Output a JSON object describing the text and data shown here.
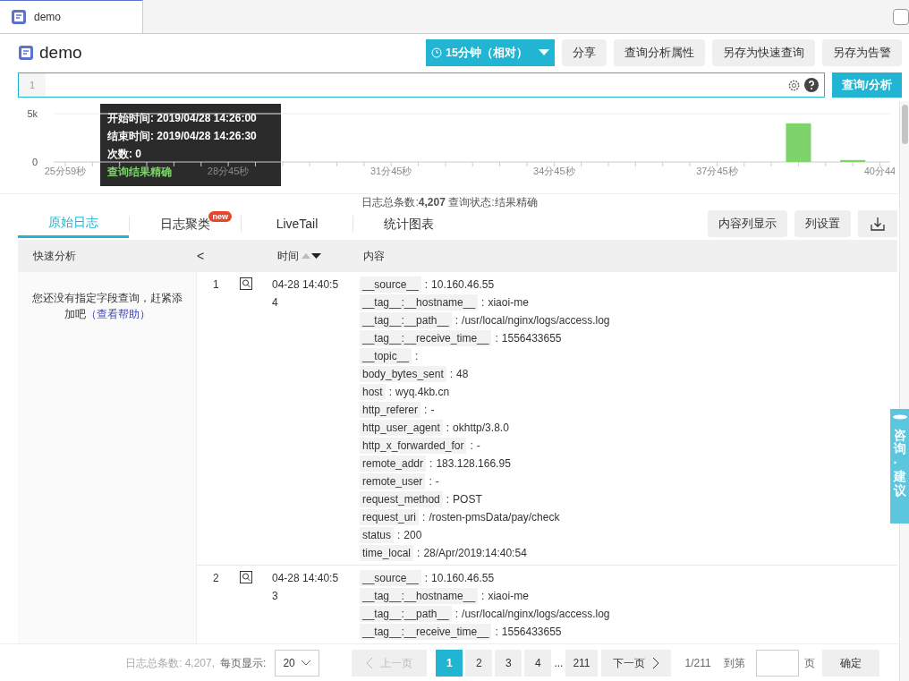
{
  "tab": {
    "label": "demo",
    "selected": true
  },
  "header": {
    "title": "demo",
    "time_range": "15分钟（相对）",
    "buttons": [
      "分享",
      "查询分析属性",
      "另存为快速查询",
      "另存为告警"
    ]
  },
  "query": {
    "line_number": "1",
    "submit": "查询/分析"
  },
  "histogram": {
    "chart_data": {
      "type": "bar",
      "categories": [
        "25分59秒",
        null,
        null,
        null,
        null,
        null,
        "28分45秒",
        null,
        null,
        null,
        null,
        null,
        "31分45秒",
        null,
        null,
        null,
        null,
        null,
        "34分45秒",
        null,
        null,
        null,
        null,
        null,
        "37分45秒",
        null,
        null,
        null,
        null,
        null,
        "40分44"
      ],
      "series": [
        {
          "color": "#7ed36b",
          "values": [
            0,
            0,
            0,
            0,
            0,
            0,
            0,
            0,
            0,
            0,
            0,
            0,
            0,
            0,
            0,
            0,
            0,
            0,
            0,
            0,
            0,
            0,
            0,
            0,
            0,
            0,
            0,
            4000,
            0,
            200,
            0
          ]
        }
      ],
      "ylim": [
        0,
        5000
      ],
      "yticks": [
        {
          "value": 0,
          "label": "0"
        },
        {
          "value": 5000,
          "label": "5k"
        }
      ]
    },
    "tooltip": {
      "lines": [
        "开始时间: 2019/04/28 14:26:00",
        "结束时间: 2019/04/28 14:26:30",
        "次数: 0"
      ],
      "status": "查询结果精确"
    }
  },
  "summary": "日志总条数:**4,207** 查询状态:结果精确",
  "view_tabs": [
    {
      "label": "原始日志",
      "selected": true
    },
    {
      "label": "日志聚类",
      "selected": false,
      "badge": "new"
    },
    {
      "label": "LiveTail",
      "selected": false
    },
    {
      "label": "统计图表",
      "selected": false
    }
  ],
  "view_buttons": [
    "内容列显示",
    "列设置"
  ],
  "table": {
    "columns": [
      "快速分析",
      "<",
      "时间",
      "内容"
    ],
    "quick_analysis": {
      "message": "您还没有指定字段查询，赶紧添加吧",
      "link": "（查看帮助）"
    },
    "rows": [
      {
        "index": "1",
        "time": "04-28 14:40:54",
        "fields": [
          {
            "key": "__source__",
            "separator": ":",
            "value": "10.160.46.55"
          },
          {
            "key": "__tag__:__hostname__",
            "separator": ":",
            "value": "xiaoi-me"
          },
          {
            "key": "__tag__:__path__",
            "separator": ":",
            "value": "/usr/local/nginx/logs/access.log"
          },
          {
            "key": "__tag__:__receive_time__",
            "separator": ":",
            "value": "1556433655"
          },
          {
            "key": "__topic__",
            "separator": ":"
          },
          {
            "key": "body_bytes_sent",
            "separator": ":",
            "value": "48"
          },
          {
            "key": "host",
            "separator": ":",
            "value": "wyq.4kb.cn"
          },
          {
            "key": "http_referer",
            "separator": ":",
            "value": "-"
          },
          {
            "key": "http_user_agent",
            "separator": ":",
            "value": "okhttp/3.8.0"
          },
          {
            "key": "http_x_forwarded_for",
            "separator": ":",
            "value": "-"
          },
          {
            "key": "remote_addr",
            "separator": ":",
            "value": "183.128.166.95"
          },
          {
            "key": "remote_user",
            "separator": ":",
            "value": "-"
          },
          {
            "key": "request_method",
            "separator": ":",
            "value": "POST"
          },
          {
            "key": "request_uri",
            "separator": ":",
            "value": "/rosten-pmsData/pay/check"
          },
          {
            "key": "status",
            "separator": ":",
            "value": "200"
          },
          {
            "key": "time_local",
            "separator": ":",
            "value": "28/Apr/2019:14:40:54"
          }
        ]
      },
      {
        "index": "2",
        "time": "04-28 14:40:53",
        "fields": [
          {
            "key": "__source__",
            "separator": ":",
            "value": "10.160.46.55"
          },
          {
            "key": "__tag__:__hostname__",
            "separator": ":",
            "value": "xiaoi-me"
          },
          {
            "key": "__tag__:__path__",
            "separator": ":",
            "value": "/usr/local/nginx/logs/access.log"
          },
          {
            "key": "__tag__:__receive_time__",
            "separator": ":",
            "value": "1556433655"
          }
        ]
      }
    ]
  },
  "pagination": {
    "total": "日志总条数: 4,207,",
    "page_size_label": "每页显示:",
    "page_size": "20",
    "prev": {
      "label": "上一页",
      "disabled": true
    },
    "pages": [
      {
        "kind": "page",
        "label": "1",
        "selected": true
      },
      {
        "kind": "page",
        "label": "2",
        "selected": false
      },
      {
        "kind": "page",
        "label": "3",
        "selected": false
      },
      {
        "kind": "page",
        "label": "4",
        "selected": false
      },
      {
        "kind": "gap",
        "label": "..."
      },
      {
        "kind": "page",
        "label": "211",
        "selected": false
      }
    ],
    "next": {
      "label": "下一页",
      "disabled": false
    },
    "current": "1/211",
    "goto_label": "到第",
    "goto_suffix": "页",
    "confirm": "确定"
  },
  "feedback_tab": "咨询·建议"
}
